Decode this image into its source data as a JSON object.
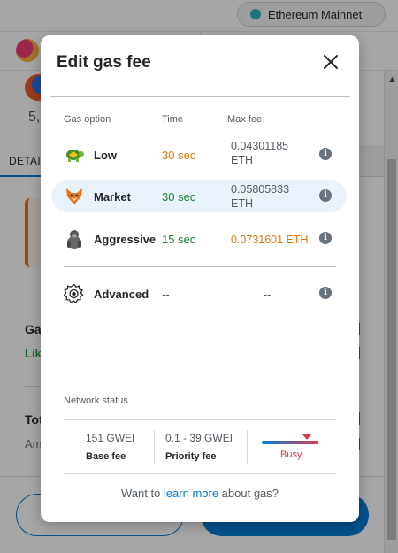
{
  "network": {
    "name": "Ethereum Mainnet",
    "dot_color": "#29b6af"
  },
  "background": {
    "amount_fragment": "5,",
    "tab_details": "DETAI",
    "gas_fragment": "Ga",
    "likely_fragment": "Lik",
    "total_fragment": "Tot",
    "amount_label_fragment": "Am"
  },
  "modal": {
    "title": "Edit gas fee",
    "columns": {
      "option": "Gas option",
      "time": "Time",
      "max_fee": "Max fee"
    },
    "options": [
      {
        "label": "Low",
        "time": "30 sec",
        "fee_line1": "0.04301185",
        "fee_line2": "ETH",
        "icon": "turtle-icon",
        "selected": false
      },
      {
        "label": "Market",
        "time": "30 sec",
        "fee_line1": "0.05805833",
        "fee_line2": "ETH",
        "icon": "fox-icon",
        "selected": true
      },
      {
        "label": "Aggressive",
        "time": "15 sec",
        "fee_line1": "0.0731601 ETH",
        "fee_line2": "",
        "icon": "gorilla-icon",
        "selected": false
      },
      {
        "label": "Advanced",
        "time": "--",
        "fee_line1": "--",
        "fee_line2": "",
        "icon": "gear-icon",
        "selected": false
      }
    ],
    "network_status": {
      "label": "Network status",
      "base_fee_value": "151 GWEI",
      "base_fee_label": "Base fee",
      "priority_fee_value": "0.1 - 39 GWEI",
      "priority_fee_label": "Priority fee",
      "congestion": "Busy"
    },
    "learn_more": {
      "prefix": "Want to ",
      "link": "learn more",
      "suffix": " about gas?"
    }
  },
  "colors": {
    "accent": "#037dd6",
    "orange": "#d97706",
    "green": "#1c8234",
    "busy": "#d73a49"
  }
}
